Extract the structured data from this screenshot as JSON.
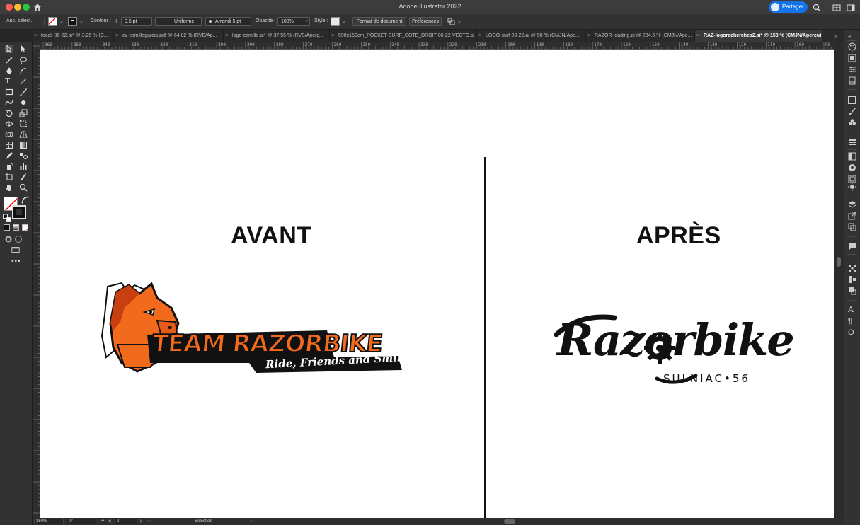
{
  "window": {
    "title": "Adobe Illustrator 2022",
    "share_label": "Partager"
  },
  "control_bar": {
    "selection_label": "Auc. sélect.",
    "stroke_label": "Contour :",
    "stroke_value": "0,5 pt",
    "profile_value": "Uniforme",
    "brush_value": "Arrondi 5 pt",
    "opacity_label": "Opacité :",
    "opacity_value": "100%",
    "style_label": "Style :",
    "document_setup_label": "Format de document",
    "preferences_label": "Préférences"
  },
  "tabs": [
    {
      "label": "tocall-06-22.ai* @ 3,25 % (C..."
    },
    {
      "label": "cv-camillegarcia.pdf @ 64,02 % (RVB/Ap..."
    },
    {
      "label": "logo-camille.ai* @ 37,55 % (RVB/Aperç..."
    },
    {
      "label": "590x150cm_POCKET-SURF_COTE_DROIT-06-22-VECTO.ai"
    },
    {
      "label": "LOGO-surf-08-22.ai @ 50 % (CMJN/Ape..."
    },
    {
      "label": "RAZOR-loading.ai @ 234,6 % (CMJN/Ape..."
    },
    {
      "label": "RAZ-logorecherches2.ai* @ 150 % (CMJN/Aperçu)",
      "active": true
    }
  ],
  "ruler": {
    "top_labels": [
      "360",
      "350",
      "340",
      "330",
      "320",
      "310",
      "300",
      "290",
      "280",
      "270",
      "260",
      "250",
      "240",
      "230",
      "220",
      "210",
      "200",
      "190",
      "180",
      "170",
      "160",
      "150",
      "140",
      "130",
      "120",
      "110",
      "100",
      "90"
    ]
  },
  "artboard": {
    "left_heading": "AVANT",
    "right_heading": "APRÈS",
    "old_logo": {
      "main_text": "TEAM RAZORBIKE",
      "tagline": "Ride, Friends and Smile"
    },
    "new_logo": {
      "wordmark": "Razorbike",
      "subline": "SULNIAC•56"
    }
  },
  "status_bar": {
    "zoom": "150%",
    "rotation": "0°",
    "artboard_number": "2",
    "tool_name": "Sélection"
  },
  "colors": {
    "accent": "#1473e6",
    "logo_orange": "#f26b1d",
    "logo_dark_orange": "#c8400f",
    "ink": "#111111"
  }
}
